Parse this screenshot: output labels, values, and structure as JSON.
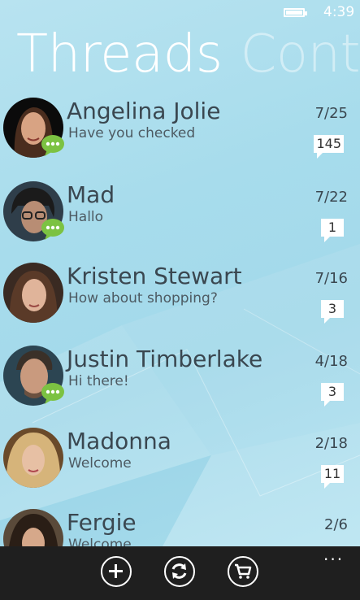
{
  "status": {
    "time": "4:39",
    "battery_icon": "battery-full-icon"
  },
  "pivot": {
    "active": "Threads",
    "next": "Contacts"
  },
  "threads": [
    {
      "name": "Angelina Jolie",
      "preview": "Have you checked",
      "date": "7/25",
      "count": "145",
      "has_chat_badge": true
    },
    {
      "name": "Mad",
      "preview": "Hallo",
      "date": "7/22",
      "count": "1",
      "has_chat_badge": true
    },
    {
      "name": "Kristen Stewart",
      "preview": "How about shopping?",
      "date": "7/16",
      "count": "3",
      "has_chat_badge": false
    },
    {
      "name": "Justin Timberlake",
      "preview": "Hi there!",
      "date": "4/18",
      "count": "3",
      "has_chat_badge": true
    },
    {
      "name": "Madonna",
      "preview": "Welcome",
      "date": "2/18",
      "count": "11",
      "has_chat_badge": false
    },
    {
      "name": "Fergie",
      "preview": "Welcome",
      "date": "2/6",
      "count": "",
      "has_chat_badge": false
    }
  ],
  "appbar": {
    "buttons": [
      "add-icon",
      "sync-icon",
      "cart-icon"
    ],
    "more": "..."
  },
  "colors": {
    "background": "#a7dcec",
    "appbar": "#1f1f1f",
    "chat_badge": "#7cc242",
    "text": "#3a4750"
  }
}
